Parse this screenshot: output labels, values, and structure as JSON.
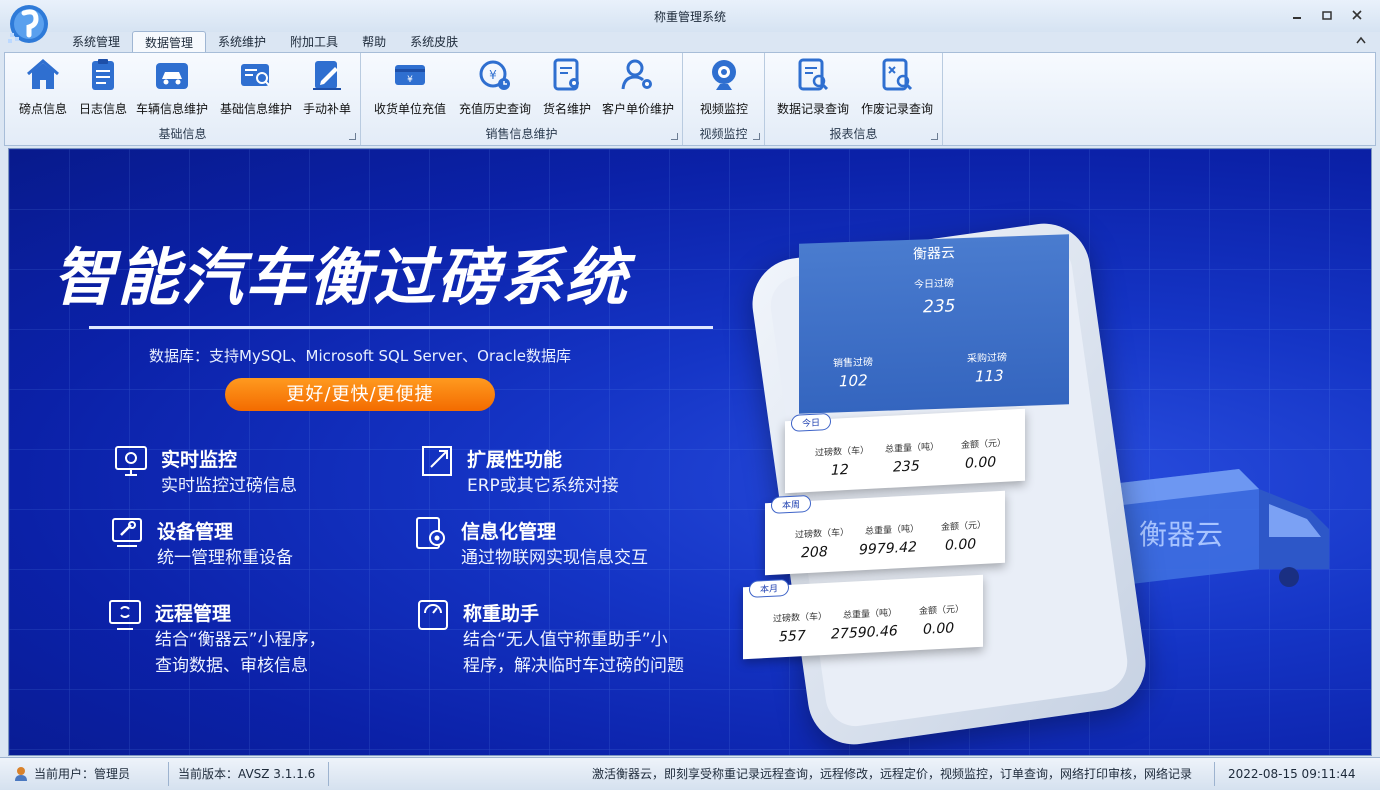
{
  "window": {
    "title": "称重管理系统",
    "controls": [
      "minimize-icon",
      "restore-icon",
      "close-icon"
    ]
  },
  "menu": {
    "tabs": [
      "系统管理",
      "数据管理",
      "系统维护",
      "附加工具",
      "帮助",
      "系统皮肤"
    ],
    "active_tab": "数据管理"
  },
  "ribbon": {
    "groups": [
      {
        "label": "基础信息",
        "buttons": [
          {
            "label": "磅点信息",
            "icon": "home-icon"
          },
          {
            "label": "日志信息",
            "icon": "clipboard-icon"
          },
          {
            "label": "车辆信息维护",
            "icon": "car-card-icon"
          },
          {
            "label": "基础信息维护",
            "icon": "info-search-icon"
          },
          {
            "label": "手动补单",
            "icon": "edit-icon"
          }
        ]
      },
      {
        "label": "销售信息维护",
        "buttons": [
          {
            "label": "收货单位充值",
            "icon": "recharge-icon"
          },
          {
            "label": "充值历史查询",
            "icon": "history-icon"
          },
          {
            "label": "货名维护",
            "icon": "goods-icon"
          },
          {
            "label": "客户单价维护",
            "icon": "user-settings-icon"
          }
        ]
      },
      {
        "label": "视频监控",
        "buttons": [
          {
            "label": "视频监控",
            "icon": "webcam-icon"
          }
        ]
      },
      {
        "label": "报表信息",
        "buttons": [
          {
            "label": "数据记录查询",
            "icon": "record-search-icon"
          },
          {
            "label": "作废记录查询",
            "icon": "void-search-icon"
          }
        ]
      }
    ]
  },
  "banner": {
    "title": "智能汽车衡过磅系统",
    "database_line": "数据库：支持MySQL、Microsoft SQL Server、Oracle数据库",
    "slogan": "更好/更快/更便捷",
    "features": [
      {
        "title": "实时监控",
        "desc": [
          "实时监控过磅信息"
        ],
        "icon": "monitor-camera-icon"
      },
      {
        "title": "扩展性功能",
        "desc": [
          "ERP或其它系统对接"
        ],
        "icon": "expand-icon"
      },
      {
        "title": "设备管理",
        "desc": [
          "统一管理称重设备"
        ],
        "icon": "device-wrench-icon"
      },
      {
        "title": "信息化管理",
        "desc": [
          "通过物联网实现信息交互"
        ],
        "icon": "doc-gear-icon"
      },
      {
        "title": "远程管理",
        "desc": [
          "结合“衡器云”小程序，",
          "查询数据、审核信息"
        ],
        "icon": "remote-monitor-icon"
      },
      {
        "title": "称重助手",
        "desc": [
          "结合“无人值守称重助手”小",
          "程序，解决临时车过磅的问题"
        ],
        "icon": "scale-icon"
      }
    ],
    "phone_app": {
      "app_name": "衡器云",
      "today_label": "今日过磅",
      "today_value": "235",
      "sales_label": "销售过磅",
      "sales_value": "102",
      "purchase_label": "采购过磅",
      "purchase_value": "113",
      "cards": [
        {
          "tag": "今日",
          "count_label": "过磅数（车）",
          "count": "12",
          "weight_label": "总重量（吨）",
          "weight": "235",
          "amount_label": "金额（元）",
          "amount": "0.00"
        },
        {
          "tag": "本周",
          "count_label": "过磅数（车）",
          "count": "208",
          "weight_label": "总重量（吨）",
          "weight": "9979.42",
          "amount_label": "金额（元）",
          "amount": "0.00"
        },
        {
          "tag": "本月",
          "count_label": "过磅数（车）",
          "count": "557",
          "weight_label": "总重量（吨）",
          "weight": "27590.46",
          "amount_label": "金额（元）",
          "amount": "0.00"
        }
      ]
    },
    "truck_label": "衡器云"
  },
  "status_bar": {
    "user": "当前用户：管理员",
    "version": "当前版本：AVSZ 3.1.1.6",
    "message": "激活衡器云，即刻享受称重记录远程查询，远程修改，远程定价，视频监控，订单查询，网络打印审核，网络记录",
    "datetime": "2022-08-15 09:11:44"
  },
  "colors": {
    "banner_blue": "#1535c6",
    "accent_orange": "#f36b00",
    "ribbon_bg": "#e3ecf7",
    "icon_blue": "#2f6fd0"
  }
}
